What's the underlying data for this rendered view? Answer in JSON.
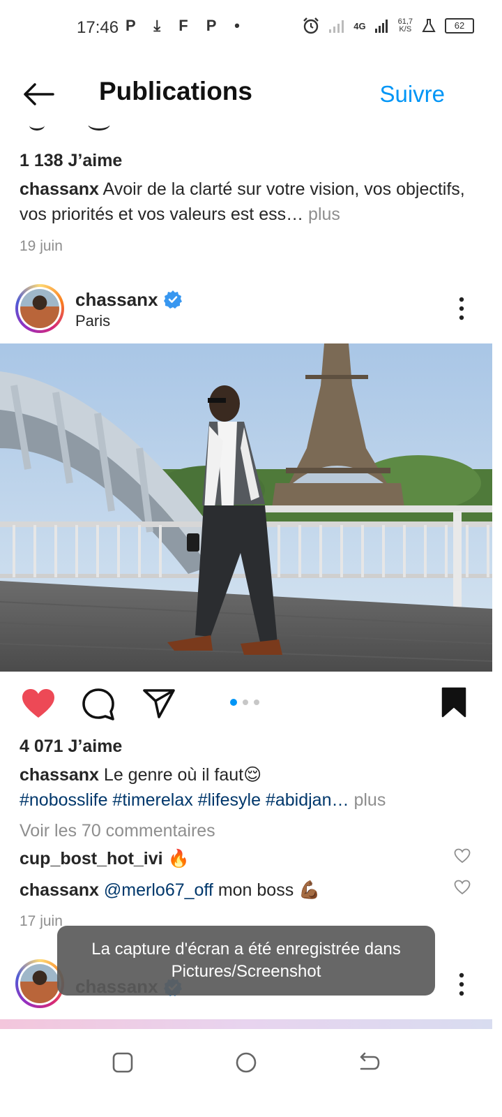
{
  "status_bar": {
    "time": "17:46",
    "left_icons": "P ⤓ F P •",
    "network": "4G",
    "net_speed_value": "61,7",
    "net_speed_unit": "K/S",
    "battery": "62"
  },
  "header": {
    "title": "Publications",
    "follow_label": "Suivre",
    "accent": "#0095f6"
  },
  "previous_post": {
    "likes": "1 138 J’aime",
    "username": "chassanx",
    "caption": "Avoir de la clarté sur votre vision, vos objectifs, vos priorités et vos valeurs est ess…",
    "more": "plus",
    "date": "19 juin"
  },
  "post": {
    "username": "chassanx",
    "location": "Paris",
    "likes": "4 071 J’aime",
    "caption": "Le genre où il faut😌",
    "hashtags": "#nobosslife #timerelax #lifesyle #abidjan…",
    "more": "plus",
    "view_comments": "Voir les 70 commentaires",
    "comments": [
      {
        "username": "cup_bost_hot_ivi",
        "text": "🔥"
      },
      {
        "username": "chassanx",
        "mention": "@merlo67_off",
        "text": "mon boss 💪🏾"
      }
    ],
    "date": "17 juin",
    "liked_color": "#ed4956",
    "carousel_pages": 3,
    "carousel_active": 1
  },
  "next_post": {
    "username": "chassanx"
  },
  "toast": {
    "line1": "La capture d'écran a été enregistrée dans",
    "line2": "Pictures/Screenshot"
  },
  "icons": {
    "back": "arrow-left-icon",
    "like": "heart-filled-icon",
    "comment": "comment-bubble-icon",
    "share": "paper-plane-icon",
    "save": "bookmark-filled-icon",
    "more": "vertical-dots-icon",
    "verified": "verified-badge-icon",
    "comment_like": "heart-outline-icon",
    "nav_recent": "square-icon",
    "nav_home": "circle-icon",
    "nav_back": "return-arrow-icon"
  }
}
